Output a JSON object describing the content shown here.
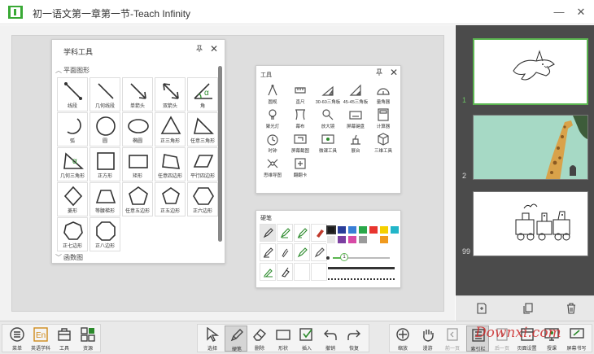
{
  "window": {
    "title": "初一语文第一章第一节-Teach Infinity",
    "minimize": "—",
    "close": "✕"
  },
  "subject_panel": {
    "title": "学科工具",
    "section_plane": "平面图形",
    "section_func": "函数图",
    "shapes": [
      {
        "label": "线段",
        "icon": "line-segment-icon"
      },
      {
        "label": "几何线段",
        "icon": "geometric-segment-icon"
      },
      {
        "label": "单箭头",
        "icon": "single-arrow-icon"
      },
      {
        "label": "双箭头",
        "icon": "double-arrow-icon"
      },
      {
        "label": "角",
        "icon": "angle-icon"
      },
      {
        "label": "弧",
        "icon": "arc-icon"
      },
      {
        "label": "圆",
        "icon": "circle-icon"
      },
      {
        "label": "椭圆",
        "icon": "ellipse-icon"
      },
      {
        "label": "正三角形",
        "icon": "equilateral-triangle-icon"
      },
      {
        "label": "任意三角形",
        "icon": "triangle-icon"
      },
      {
        "label": "几何三角形",
        "icon": "geometric-triangle-icon"
      },
      {
        "label": "正方形",
        "icon": "square-icon"
      },
      {
        "label": "矩形",
        "icon": "rectangle-icon"
      },
      {
        "label": "任意四边形",
        "icon": "quadrilateral-icon"
      },
      {
        "label": "平行四边形",
        "icon": "parallelogram-icon"
      },
      {
        "label": "菱形",
        "icon": "rhombus-icon"
      },
      {
        "label": "等腰梯形",
        "icon": "trapezoid-icon"
      },
      {
        "label": "任意五边形",
        "icon": "pentagon-icon"
      },
      {
        "label": "正五边形",
        "icon": "regular-pentagon-icon"
      },
      {
        "label": "正六边形",
        "icon": "hexagon-icon"
      },
      {
        "label": "正七边形",
        "icon": "heptagon-icon"
      },
      {
        "label": "正八边形",
        "icon": "octagon-icon"
      }
    ]
  },
  "tools_panel": {
    "title": "工具",
    "items": [
      {
        "label": "圆规",
        "icon": "compass-icon"
      },
      {
        "label": "直尺",
        "icon": "ruler-icon"
      },
      {
        "label": "30-60三角板",
        "icon": "set-square-30-icon"
      },
      {
        "label": "45-45三角板",
        "icon": "set-square-45-icon"
      },
      {
        "label": "量角器",
        "icon": "protractor-icon"
      },
      {
        "label": "聚光灯",
        "icon": "spotlight-icon"
      },
      {
        "label": "幕布",
        "icon": "curtain-icon"
      },
      {
        "label": "放大镜",
        "icon": "magnifier-icon"
      },
      {
        "label": "屏幕键盘",
        "icon": "keyboard-icon"
      },
      {
        "label": "计算器",
        "icon": "calculator-icon"
      },
      {
        "label": "时钟",
        "icon": "clock-icon"
      },
      {
        "label": "屏幕截图",
        "icon": "screenshot-icon"
      },
      {
        "label": "微课工具",
        "icon": "microlesson-icon"
      },
      {
        "label": "展台",
        "icon": "visualizer-icon"
      },
      {
        "label": "三维工具",
        "icon": "cube-icon"
      },
      {
        "label": "思维导图",
        "icon": "mindmap-icon"
      },
      {
        "label": "翻翻卡",
        "icon": "flipcard-icon"
      }
    ]
  },
  "brush_panel": {
    "title": "硬笔",
    "colors": [
      "#1c1c1c",
      "#2a3e9a",
      "#3a7fd6",
      "#2aa84a",
      "#e8352f",
      "#f5d000",
      "#22b5c8",
      "#e6e6e6",
      "#7b3fa0",
      "#d74aa6",
      "#9a9a9a",
      "#ffffff",
      "#f09a1e"
    ],
    "selected_color": "#1c1c1c",
    "size_value": "1",
    "size_level": 0.2
  },
  "slides": [
    {
      "number": "1",
      "active": true
    },
    {
      "number": "2",
      "active": false
    },
    {
      "number": "99",
      "active": false
    }
  ],
  "toolbar": {
    "left": [
      {
        "label": "菜单",
        "icon": "menu-icon"
      },
      {
        "label": "英语学科",
        "icon": "english-subject-icon"
      },
      {
        "label": "工具",
        "icon": "toolbox-icon"
      },
      {
        "label": "资源",
        "icon": "resource-icon"
      }
    ],
    "center": [
      {
        "label": "选择",
        "icon": "cursor-icon"
      },
      {
        "label": "硬笔",
        "icon": "pen-icon"
      },
      {
        "label": "删除",
        "icon": "eraser-icon"
      },
      {
        "label": "形状",
        "icon": "shape-icon"
      },
      {
        "label": "插入",
        "icon": "insert-icon"
      },
      {
        "label": "撤销",
        "icon": "undo-icon"
      },
      {
        "label": "恢复",
        "icon": "redo-icon"
      }
    ],
    "right": [
      {
        "label": "缩放",
        "icon": "zoom-icon"
      },
      {
        "label": "漫游",
        "icon": "pan-icon"
      },
      {
        "label": "前一页",
        "icon": "prev-page-icon"
      },
      {
        "label": "索引栏",
        "icon": "index-icon"
      },
      {
        "label": "后一页",
        "icon": "next-page-icon"
      },
      {
        "label": "页面设置",
        "icon": "page-setting-icon"
      },
      {
        "label": "授课",
        "icon": "teach-icon"
      },
      {
        "label": "屏幕书写",
        "icon": "screen-write-icon"
      }
    ]
  },
  "watermark": "Downxi.com"
}
